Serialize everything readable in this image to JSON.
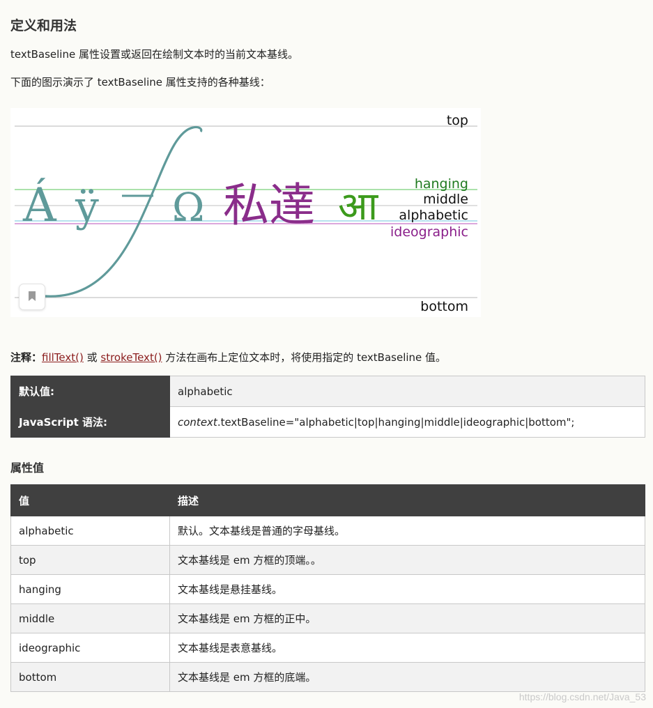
{
  "section_title": "定义和用法",
  "intro": "textBaseline 属性设置或返回在绘制文本时的当前文本基线。",
  "figure_caption": "下面的图示演示了 textBaseline 属性支持的各种基线：",
  "figure": {
    "baseline_labels": {
      "top": "top",
      "hanging": "hanging",
      "middle": "middle",
      "alphabetic": "alphabetic",
      "ideographic": "ideographic",
      "bottom": "bottom"
    },
    "glyphs": {
      "latin1": "Á",
      "latin2": "ÿ",
      "greek": "Ω",
      "cjk": "私達",
      "devanagari": "आ"
    },
    "colors": {
      "teal": "#5f9a9a",
      "purple": "#8a2d8a",
      "green": "#3c9a1c",
      "hanging_label": "#1f7a1f",
      "ideographic_label": "#8a1f8a",
      "text_dark": "#111111"
    },
    "icon": "bookmark-icon"
  },
  "note": {
    "prefix": "注释：",
    "link1": "fillText()",
    "middle": " 或 ",
    "link2": "strokeText()",
    "suffix": " 方法在画布上定位文本时，将使用指定的 textBaseline 值。"
  },
  "info_table": {
    "default_label": "默认值:",
    "default_value": "alphabetic",
    "syntax_label": "JavaScript 语法:",
    "syntax_context": "context",
    "syntax_rest": ".textBaseline=\"alphabetic|top|hanging|middle|ideographic|bottom\";"
  },
  "values_title": "属性值",
  "values_table": {
    "headers": [
      "值",
      "描述"
    ],
    "rows": [
      [
        "alphabetic",
        "默认。文本基线是普通的字母基线。"
      ],
      [
        "top",
        "文本基线是 em 方框的顶端。。"
      ],
      [
        "hanging",
        "文本基线是悬挂基线。"
      ],
      [
        "middle",
        "文本基线是 em 方框的正中。"
      ],
      [
        "ideographic",
        "文本基线是表意基线。"
      ],
      [
        "bottom",
        "文本基线是 em 方框的底端。"
      ]
    ]
  },
  "watermark": "https://blog.csdn.net/Java_53"
}
